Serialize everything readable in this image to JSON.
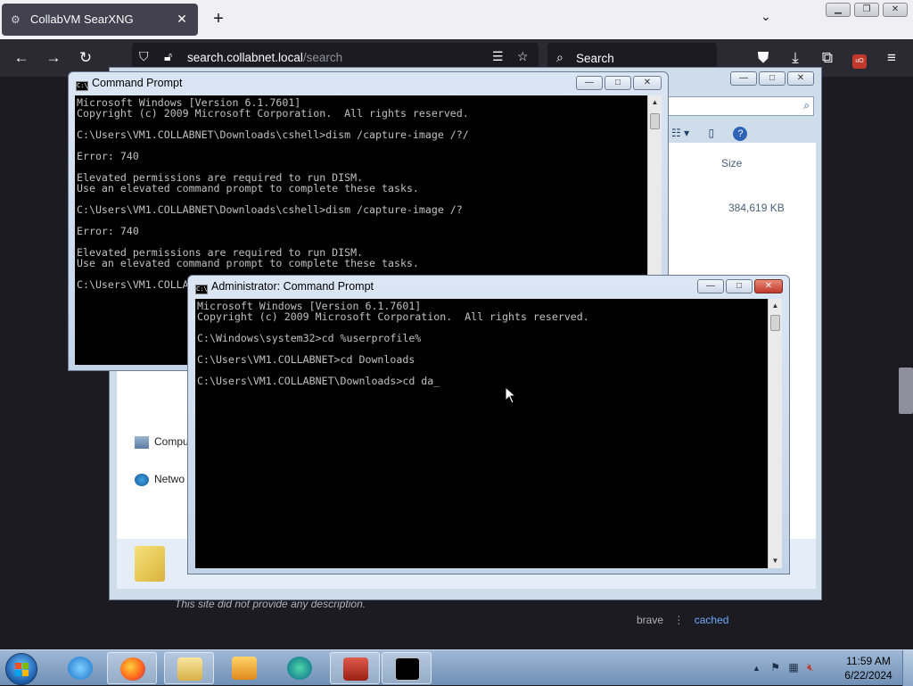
{
  "browser": {
    "tab": {
      "title": "CollabVM SearXNG",
      "icon": "searxng-icon",
      "close": "✕"
    },
    "new_tab": "+",
    "tabs_dropdown": "⌄",
    "url": {
      "domain": "search.collabnet.local",
      "path": "/search"
    },
    "search_placeholder": "Search",
    "win_controls": [
      "▭",
      "❐",
      "✕"
    ]
  },
  "page": {
    "description": "This site did not provide any description.",
    "engine": "brave",
    "separator": "⋮",
    "cached": "cached"
  },
  "explorer": {
    "size_header": "Size",
    "size_value": "384,619 KB",
    "nav": [
      {
        "label": "Compu",
        "icon": "computer-icon"
      },
      {
        "label": "Netwo",
        "icon": "network-icon"
      }
    ]
  },
  "cmd1": {
    "title": "Command Prompt",
    "lines": [
      "Microsoft Windows [Version 6.1.7601]",
      "Copyright (c) 2009 Microsoft Corporation.  All rights reserved.",
      "",
      "C:\\Users\\VM1.COLLABNET\\Downloads\\cshell>dism /capture-image /?/",
      "",
      "Error: 740",
      "",
      "Elevated permissions are required to run DISM.",
      "Use an elevated command prompt to complete these tasks.",
      "",
      "C:\\Users\\VM1.COLLABNET\\Downloads\\cshell>dism /capture-image /?",
      "",
      "Error: 740",
      "",
      "Elevated permissions are required to run DISM.",
      "Use an elevated command prompt to complete these tasks.",
      "",
      "C:\\Users\\VM1.COLLABNET\\Downloads\\cshell>"
    ]
  },
  "cmd2": {
    "title": "Administrator: Command Prompt",
    "lines": [
      "Microsoft Windows [Version 6.1.7601]",
      "Copyright (c) 2009 Microsoft Corporation.  All rights reserved.",
      "",
      "C:\\Windows\\system32>cd %userprofile%",
      "",
      "C:\\Users\\VM1.COLLABNET>cd Downloads",
      "",
      "C:\\Users\\VM1.COLLABNET\\Downloads>cd da_"
    ]
  },
  "console_controls": {
    "minimize": "—",
    "maximize": "□",
    "close": "✕"
  },
  "taskbar": {
    "apps": [
      "internet-explorer-icon",
      "firefox-icon",
      "file-explorer-icon",
      "media-player-icon",
      "edge-icon",
      "toolbox-icon",
      "command-prompt-icon"
    ],
    "tray_chevron": "▲",
    "time": "11:59 AM",
    "date": "6/22/2024"
  }
}
